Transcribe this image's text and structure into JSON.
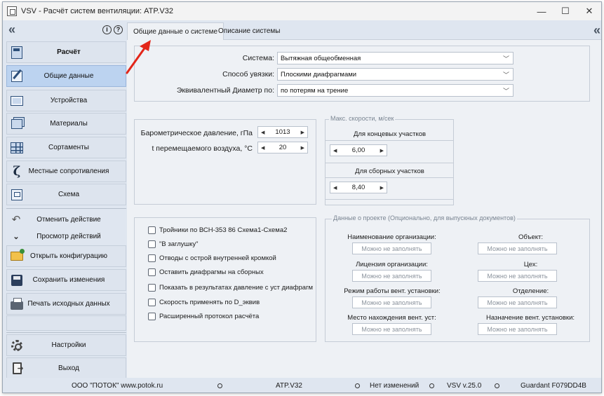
{
  "window": {
    "title": "VSV - Расчёт систем вентиляции: ATP.V32",
    "controls": {
      "minimize": "—",
      "maximize": "☐",
      "close": "✕"
    }
  },
  "sidebar": {
    "collapse_icon": "«",
    "info_icon": "i",
    "help_icon": "?",
    "items": [
      {
        "label": "Расчёт",
        "icon": "calculator-icon"
      },
      {
        "label": "Общие данные",
        "icon": "edit-icon"
      },
      {
        "label": "Устройства",
        "icon": "device-icon"
      },
      {
        "label": "Материалы",
        "icon": "layers-icon"
      },
      {
        "label": "Сортаменты",
        "icon": "grid-icon"
      },
      {
        "label": "Местные сопротивления",
        "icon": "zeta-icon"
      },
      {
        "label": "Схема",
        "icon": "scheme-icon"
      },
      {
        "label": "Отменить действие",
        "icon": "undo-icon"
      },
      {
        "label": "Просмотр действий",
        "icon": "chevron-down-icon"
      },
      {
        "label": "Открыть конфигурацию",
        "icon": "folder-icon"
      },
      {
        "label": "Сохранить изменения",
        "icon": "save-icon"
      },
      {
        "label": "Печать исходных данных",
        "icon": "printer-icon"
      },
      {
        "label": "Настройки",
        "icon": "gear-icon"
      },
      {
        "label": "Выход",
        "icon": "exit-icon"
      }
    ]
  },
  "tabs": [
    {
      "label": "Общие данные о системе",
      "active": true
    },
    {
      "label": "Описание системы",
      "active": false
    }
  ],
  "right_collapse_icon": "«",
  "system": {
    "system_label": "Система:",
    "system_value": "Вытяжная  общеобменная",
    "link_label": "Способ увязки:",
    "link_value": "Плоскими диафрагмами",
    "diameter_label": "Эквивалентный Диаметр по:",
    "diameter_value": "по потерям на трение"
  },
  "params": {
    "pressure_label": "Барометрическое давление, гПа",
    "pressure_value": "1013",
    "temp_label": "t перемещаемого воздуха, °С",
    "temp_value": "20"
  },
  "velocities": {
    "title": "Макс. скорости, м/сек",
    "end_label": "Для концевых участков",
    "end_value": "6,00",
    "collect_label": "Для сборных участков",
    "collect_value": "8,40"
  },
  "options": [
    {
      "label": "Тройники по  ВСН-353 86 Схема1-Схема2",
      "checked": false
    },
    {
      "label": "\"В заглушку\"",
      "checked": false
    },
    {
      "label": "Отводы с острой внутренней кромкой",
      "checked": false
    },
    {
      "label": "Оставить диафрагмы на сборных",
      "checked": false
    },
    {
      "label": "Показать в результатах давление с уст диафрагм",
      "checked": false
    },
    {
      "label": "Скорость применять по D_эквив",
      "checked": false
    },
    {
      "label": "Расширенный протокол расчёта",
      "checked": false
    }
  ],
  "project": {
    "title": "Данные о проекте (Опционально, для выпускных документов)",
    "placeholder": "Можно не заполнять",
    "fields": [
      {
        "label": "Наименование организации:"
      },
      {
        "label": "Объект:"
      },
      {
        "label": "Лицензия организации:"
      },
      {
        "label": "Цех:"
      },
      {
        "label": "Режим работы вент. установки:"
      },
      {
        "label": "Отделение:"
      },
      {
        "label": "Место нахождения вент. уст:"
      },
      {
        "label": "Назначение вент. установки:"
      }
    ]
  },
  "status": {
    "company": "ООО \"ПОТОК\" www.potok.ru",
    "file": "ATP.V32",
    "changes": "Нет изменений",
    "version": "VSV v.25.0",
    "guardant": "Guardant F079DD4B"
  },
  "colors": {
    "sidebar_bg": "#dfe6f0",
    "active_item": "#bcd3f0",
    "content_bg": "#eef1f5",
    "annotation_arrow": "#e32619"
  }
}
